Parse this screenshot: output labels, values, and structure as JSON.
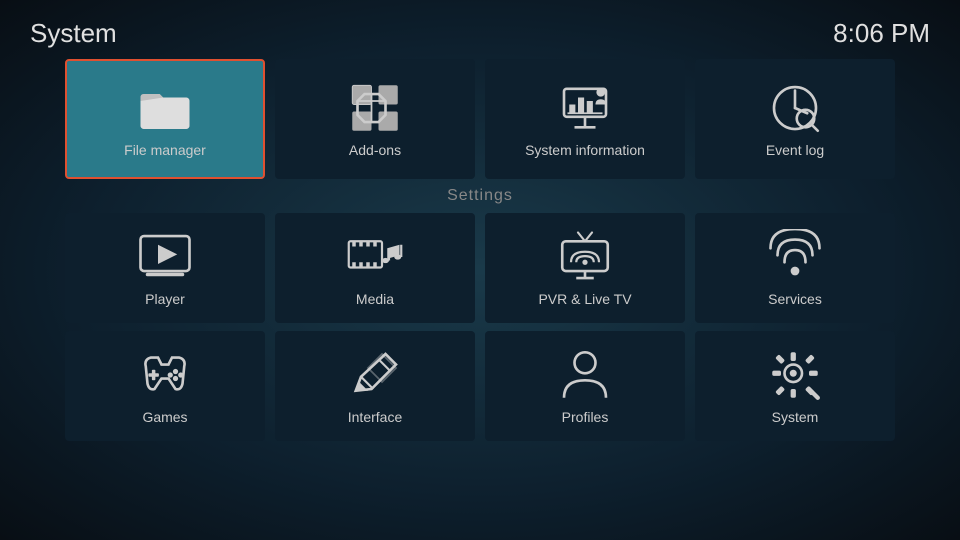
{
  "header": {
    "title": "System",
    "time": "8:06 PM"
  },
  "top_row": [
    {
      "id": "file-manager",
      "label": "File manager",
      "selected": true
    },
    {
      "id": "add-ons",
      "label": "Add-ons",
      "selected": false
    },
    {
      "id": "system-information",
      "label": "System information",
      "selected": false
    },
    {
      "id": "event-log",
      "label": "Event log",
      "selected": false
    }
  ],
  "settings_label": "Settings",
  "settings_row1": [
    {
      "id": "player",
      "label": "Player"
    },
    {
      "id": "media",
      "label": "Media"
    },
    {
      "id": "pvr-live-tv",
      "label": "PVR & Live TV"
    },
    {
      "id": "services",
      "label": "Services"
    }
  ],
  "settings_row2": [
    {
      "id": "games",
      "label": "Games"
    },
    {
      "id": "interface",
      "label": "Interface"
    },
    {
      "id": "profiles",
      "label": "Profiles"
    },
    {
      "id": "system",
      "label": "System"
    }
  ]
}
